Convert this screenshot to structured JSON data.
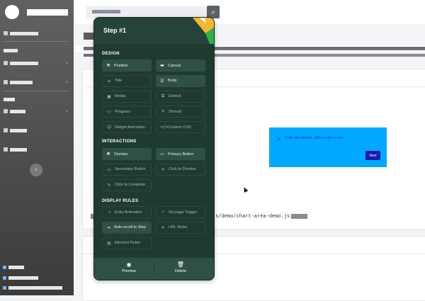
{
  "search": {
    "icon": "search-icon"
  },
  "preview": {
    "text": "Body placeholder, click to edit or style",
    "next": "Next",
    "close_glyph": "✕"
  },
  "code": {
    "path": "js/demo/chart-area-demo.js"
  },
  "panel": {
    "title": "Step #1",
    "sections": {
      "design": "DESIGN",
      "interactions": "INTERACTIONS",
      "display_rules": "DISPLAY RULES"
    },
    "design": [
      {
        "label": "Position",
        "icon": "move-icon",
        "glyph": "✥"
      },
      {
        "label": "Canvas",
        "icon": "canvas-icon",
        "glyph": "▬"
      },
      {
        "label": "Title",
        "icon": "title-icon",
        "glyph": "≡"
      },
      {
        "label": "Body",
        "icon": "body-icon",
        "glyph": "☰"
      },
      {
        "label": "Media",
        "icon": "media-icon",
        "glyph": "▣"
      },
      {
        "label": "Embed",
        "icon": "embed-icon",
        "glyph": "⧉"
      },
      {
        "label": "Progress",
        "icon": "progress-icon",
        "glyph": "▭"
      },
      {
        "label": "Shroud",
        "icon": "shroud-icon",
        "glyph": "☀"
      },
      {
        "label": "Delight Animation",
        "icon": "animation-icon",
        "glyph": "☺"
      },
      {
        "label": "Custom CSS",
        "icon": "code-icon",
        "glyph": "</>"
      }
    ],
    "interactions": [
      {
        "label": "Dismiss",
        "icon": "dismiss-icon",
        "glyph": "✖"
      },
      {
        "label": "Primary Button",
        "icon": "primary-button-icon",
        "glyph": "▭"
      },
      {
        "label": "Secondary Button",
        "icon": "secondary-button-icon",
        "glyph": "▭"
      },
      {
        "label": "Click to Dismiss",
        "icon": "close-icon",
        "glyph": "✕"
      },
      {
        "label": "Click to Complete",
        "icon": "complete-icon",
        "glyph": "↻"
      }
    ],
    "display_rules": [
      {
        "label": "Entry Animation",
        "icon": "entry-animation-icon",
        "glyph": "⇢"
      },
      {
        "label": "On-page Trigger",
        "icon": "trigger-icon",
        "glyph": "⚡"
      },
      {
        "label": "Auto-scroll to Step",
        "icon": "scroll-icon",
        "glyph": "⇥"
      },
      {
        "label": "URL Rules",
        "icon": "link-icon",
        "glyph": "⚭"
      },
      {
        "label": "Element Rules",
        "icon": "element-icon",
        "glyph": "▤"
      }
    ],
    "footer": {
      "preview_label": "Preview",
      "delete_label": "Delete",
      "preview_icon": "eye-icon",
      "delete_icon": "trash-icon"
    }
  },
  "colors": {
    "panel_bg": "#1f3b30",
    "accent_yellow": "#f5b82e",
    "accent_green": "#2db34a",
    "preview_bg": "#00a8ff"
  }
}
